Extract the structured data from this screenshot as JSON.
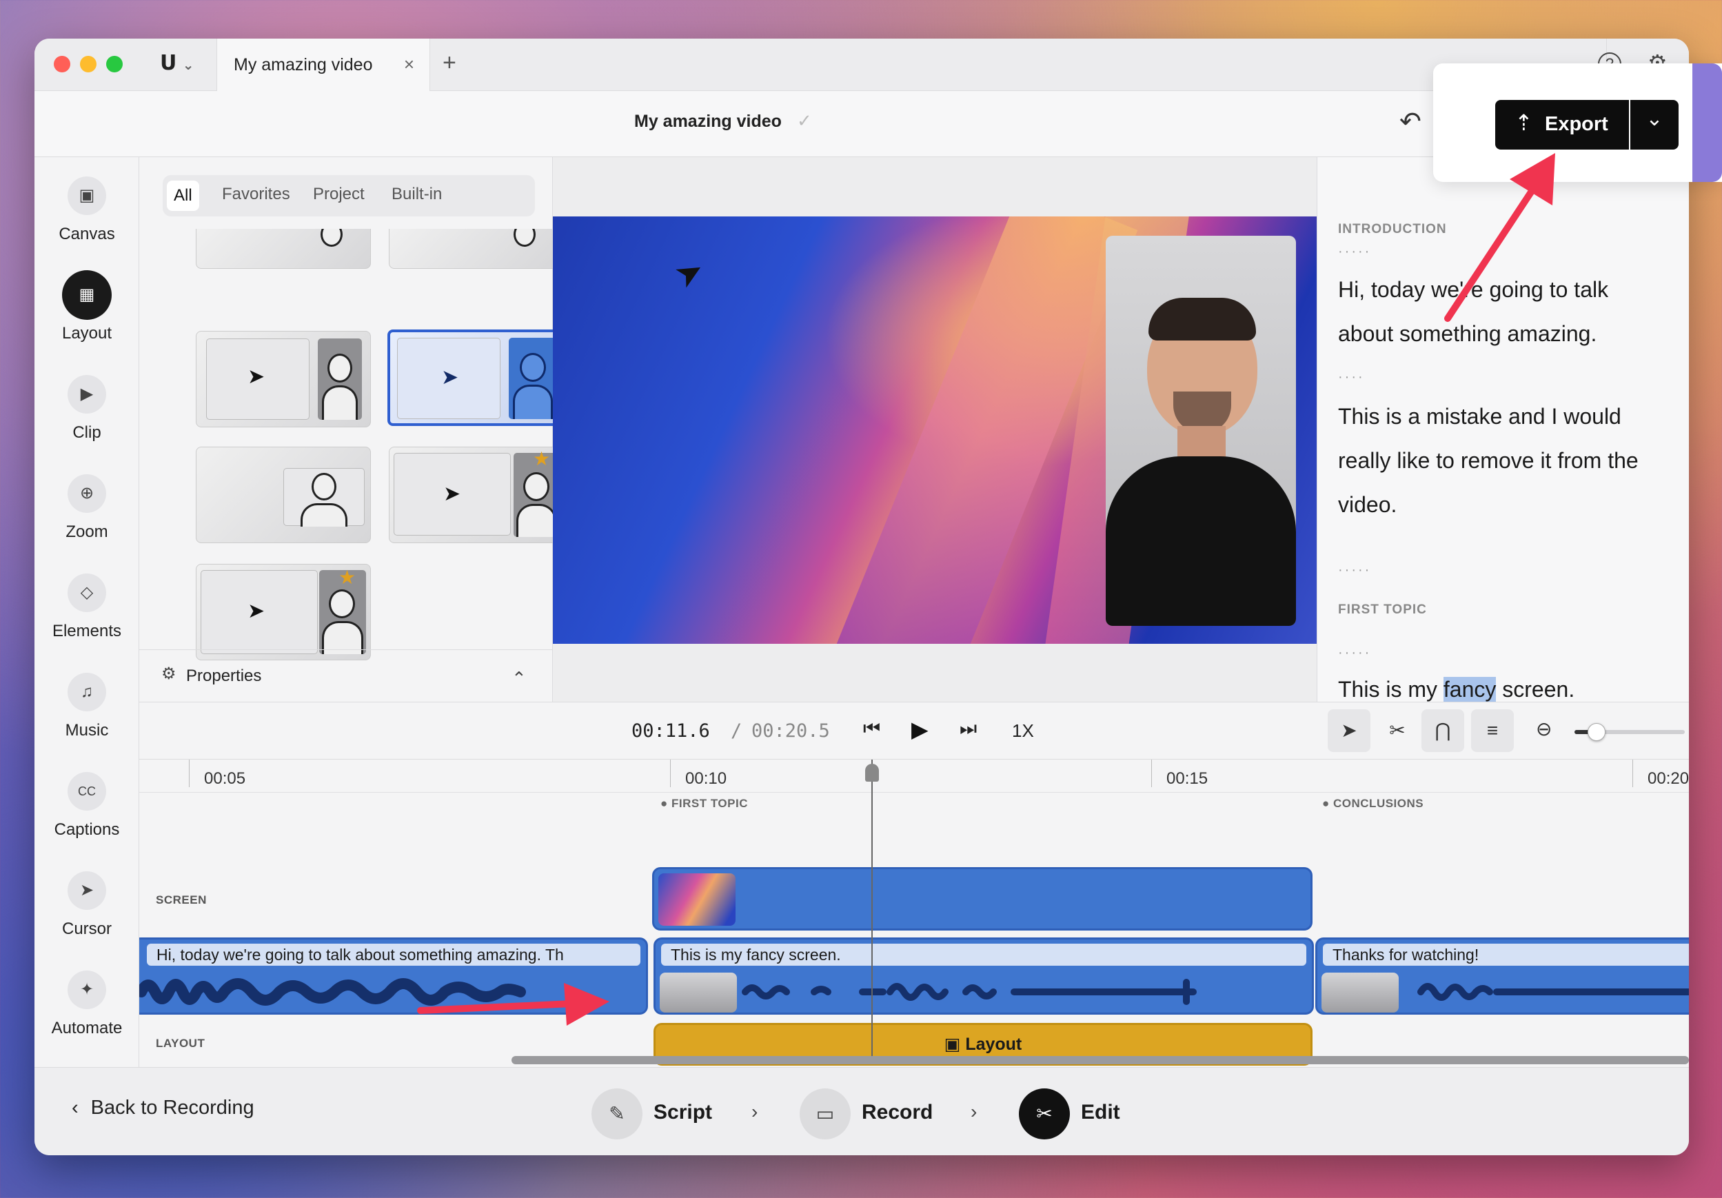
{
  "window": {
    "tab_title": "My amazing video",
    "tab_close": "×",
    "new_tab": "+",
    "doc_title": "My amazing video",
    "saved_mark": "✓",
    "app_menu": "⌄"
  },
  "header": {
    "export_label": "Export",
    "export_dropdown": "⌄",
    "undo": "↶",
    "redo": "↷",
    "help": "?",
    "settings": "⚙"
  },
  "rail": {
    "items": [
      {
        "label": "Canvas",
        "icon": "image-icon",
        "glyph": "▣"
      },
      {
        "label": "Layout",
        "icon": "layout-icon",
        "glyph": "▦"
      },
      {
        "label": "Clip",
        "icon": "clip-icon",
        "glyph": "▶"
      },
      {
        "label": "Zoom",
        "icon": "zoom-icon",
        "glyph": "⊕"
      },
      {
        "label": "Elements",
        "icon": "elements-icon",
        "glyph": "◇"
      },
      {
        "label": "Music",
        "icon": "music-icon",
        "glyph": "♫"
      },
      {
        "label": "Captions",
        "icon": "captions-icon",
        "glyph": "CC"
      },
      {
        "label": "Cursor",
        "icon": "cursor-icon",
        "glyph": "➤"
      },
      {
        "label": "Automate",
        "icon": "automate-icon",
        "glyph": "✦"
      }
    ],
    "active": "Layout"
  },
  "layouts_panel": {
    "filters": [
      "All",
      "Favorites",
      "Project",
      "Built-in"
    ],
    "active_filter": "All",
    "properties_label": "Properties",
    "properties_caret": "⌃"
  },
  "script": {
    "sections": [
      {
        "title": "INTRODUCTION",
        "dots": "·····",
        "text": "Hi, today we're going to talk about something amazing."
      },
      {
        "dots": "····",
        "text": "This is a mistake and I would really like to remove it from the video."
      },
      {
        "dots": "·····"
      },
      {
        "title": "FIRST TOPIC",
        "dots": "·····",
        "text_before": "This is my ",
        "text_highlight": "fancy",
        "text_after": " screen."
      },
      {
        "dots": "······"
      }
    ]
  },
  "transport": {
    "current_time": "00:11.6",
    "separator": "/",
    "total_time": "00:20.5",
    "speed": "1X",
    "zoom_level": 0.2
  },
  "timeline": {
    "ruler": [
      "00:05",
      "00:10",
      "00:15",
      "00:20"
    ],
    "markers": [
      "FIRST TOPIC",
      "CONCLUSIONS"
    ],
    "tracks": {
      "screen_label": "SCREEN",
      "layout_label": "LAYOUT"
    },
    "captions": [
      "Hi, today we're going to talk about something amazing. Th",
      "This is my fancy screen.",
      "Thanks for watching!"
    ],
    "layout_clip_label": "Layout"
  },
  "bottom": {
    "back_label": "Back to Recording",
    "steps": [
      {
        "label": "Script",
        "icon": "script-icon"
      },
      {
        "label": "Record",
        "icon": "camera-icon"
      },
      {
        "label": "Edit",
        "icon": "scissors-icon"
      }
    ],
    "active_step": "Edit"
  },
  "colors": {
    "accent_blue": "#3f76cf",
    "layout_yellow": "#dca522",
    "annotation_red": "#f0344f",
    "export_black": "#0d0d0d"
  }
}
